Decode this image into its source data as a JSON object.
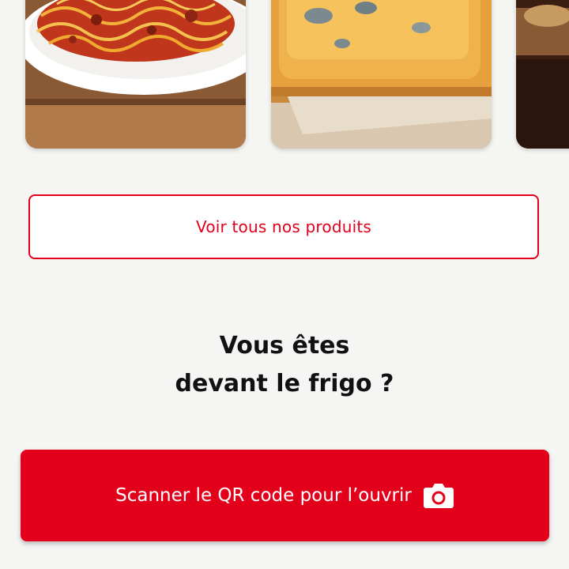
{
  "products": [
    {
      "name": "spaghetti-bolognese",
      "image": "spaghetti-icon"
    },
    {
      "name": "baked-pastry",
      "image": "pastry-icon"
    },
    {
      "name": "chocolate-dessert",
      "image": "dessert-icon"
    }
  ],
  "see_all_label": "Voir tous nos produits",
  "headline": {
    "line1": "Vous êtes",
    "line2": "devant le frigo ?"
  },
  "scan_button": {
    "label": "Scanner le QR code pour l’ouvrir",
    "icon": "camera-icon"
  },
  "colors": {
    "brand_red": "#e3001b",
    "background": "#f5f6f4",
    "text_dark": "#111111"
  }
}
